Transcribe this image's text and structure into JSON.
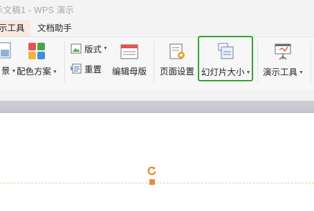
{
  "window": {
    "title": "示文稿1 - WPS 演示"
  },
  "tabs": {
    "active": "示工具",
    "doc_helper": "文档助手"
  },
  "ribbon": {
    "partial_left_label": "景",
    "color_scheme": "配色方案",
    "layout": "版式",
    "reset": "重置",
    "edit_master": "编辑母版",
    "page_setup": "页面设置",
    "slide_size": "幻灯片大小",
    "present_tools": "演示工具"
  },
  "colors": {
    "highlight": "#2ea52e",
    "accent": "#e78a48",
    "tab_active_bg": "#fae9e1"
  }
}
